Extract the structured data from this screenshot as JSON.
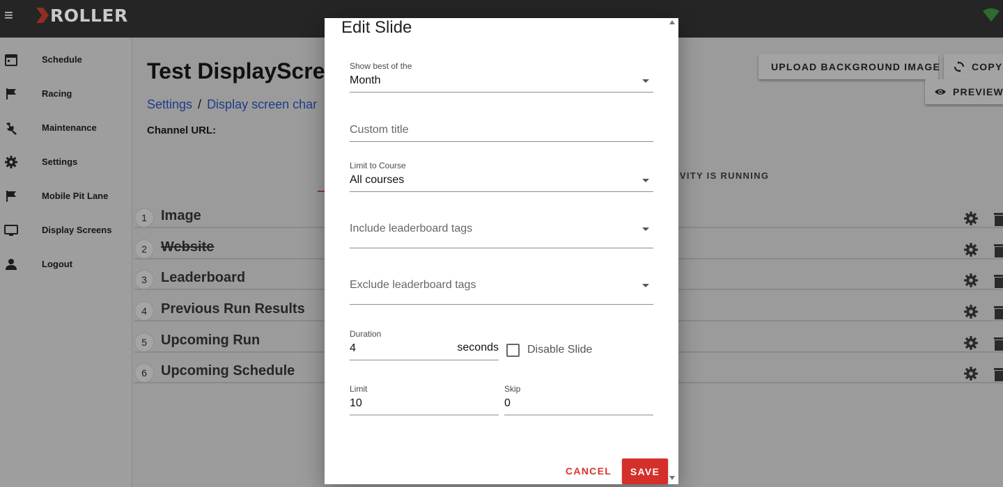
{
  "app": {
    "logo_text": "ROLLER"
  },
  "sidebar": {
    "items": [
      {
        "label": "Schedule"
      },
      {
        "label": "Racing"
      },
      {
        "label": "Maintenance"
      },
      {
        "label": "Settings"
      },
      {
        "label": "Mobile Pit Lane"
      },
      {
        "label": "Display Screens"
      },
      {
        "label": "Logout"
      }
    ]
  },
  "page": {
    "title": "Test DisplayScree",
    "breadcrumb": [
      "Settings",
      "Display screen char"
    ],
    "breadcrumb_separator": "/",
    "channel_url_label": "Channel URL:",
    "activity_tab_text": "IVITY IS RUNNING"
  },
  "toolbar": {
    "upload_label": "UPLOAD BACKGROUND IMAGE",
    "copy_label": "COPY",
    "preview_label": "PREVIEW"
  },
  "slides": [
    {
      "number": "1",
      "name": "Image",
      "struck": false
    },
    {
      "number": "2",
      "name": "Website",
      "struck": true
    },
    {
      "number": "3",
      "name": "Leaderboard",
      "struck": false
    },
    {
      "number": "4",
      "name": "Previous Run Results",
      "struck": false
    },
    {
      "number": "5",
      "name": "Upcoming Run",
      "struck": false
    },
    {
      "number": "6",
      "name": "Upcoming Schedule",
      "struck": false
    }
  ],
  "dialog": {
    "title": "Edit Slide",
    "show_best": {
      "label": "Show best of the",
      "value": "Month"
    },
    "custom_title": {
      "placeholder": "Custom title"
    },
    "limit_course": {
      "label": "Limit to Course",
      "value": "All courses"
    },
    "include_tags": {
      "placeholder": "Include leaderboard tags"
    },
    "exclude_tags": {
      "placeholder": "Exclude leaderboard tags"
    },
    "duration": {
      "label": "Duration",
      "value": "4",
      "suffix": "seconds"
    },
    "disable_slide": {
      "label": "Disable Slide",
      "checked": false
    },
    "limit": {
      "label": "Limit",
      "value": "10"
    },
    "skip": {
      "label": "Skip",
      "value": "0"
    },
    "cancel_label": "CANCEL",
    "save_label": "SAVE"
  }
}
